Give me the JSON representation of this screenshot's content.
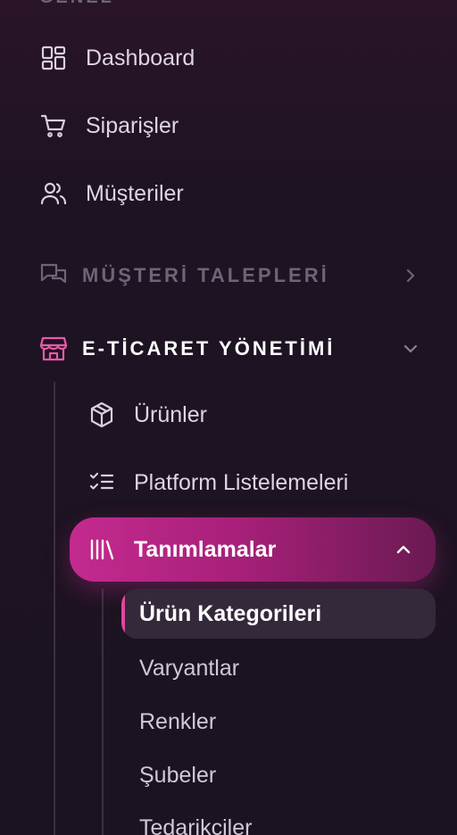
{
  "sidebar": {
    "section_title": "GENEL",
    "items": [
      {
        "label": "Dashboard",
        "icon": "dashboard-grid-icon"
      },
      {
        "label": "Siparişler",
        "icon": "shopping-cart-icon"
      },
      {
        "label": "Müşteriler",
        "icon": "users-icon"
      }
    ],
    "groups": [
      {
        "label": "MÜŞTERİ TALEPLERİ",
        "icon": "chat-bubbles-icon",
        "expanded": false
      },
      {
        "label": "E-TİCARET YÖNETİMİ",
        "icon": "storefront-icon",
        "expanded": true
      }
    ],
    "ecommerce_items": [
      {
        "label": "Ürünler",
        "icon": "box-icon"
      },
      {
        "label": "Platform Listelemeleri",
        "icon": "checklist-icon"
      },
      {
        "label": "Tanımlamalar",
        "icon": "library-icon",
        "active": true
      }
    ],
    "definitions": [
      {
        "label": "Ürün Kategorileri",
        "active": true
      },
      {
        "label": "Varyantlar"
      },
      {
        "label": "Renkler"
      },
      {
        "label": "Şubeler"
      },
      {
        "label": "Tedarikçiler"
      }
    ]
  },
  "colors": {
    "accent": "#c42a8f",
    "accent_active_bar": "#e0469e",
    "icon_highlight": "#e85aa8"
  }
}
